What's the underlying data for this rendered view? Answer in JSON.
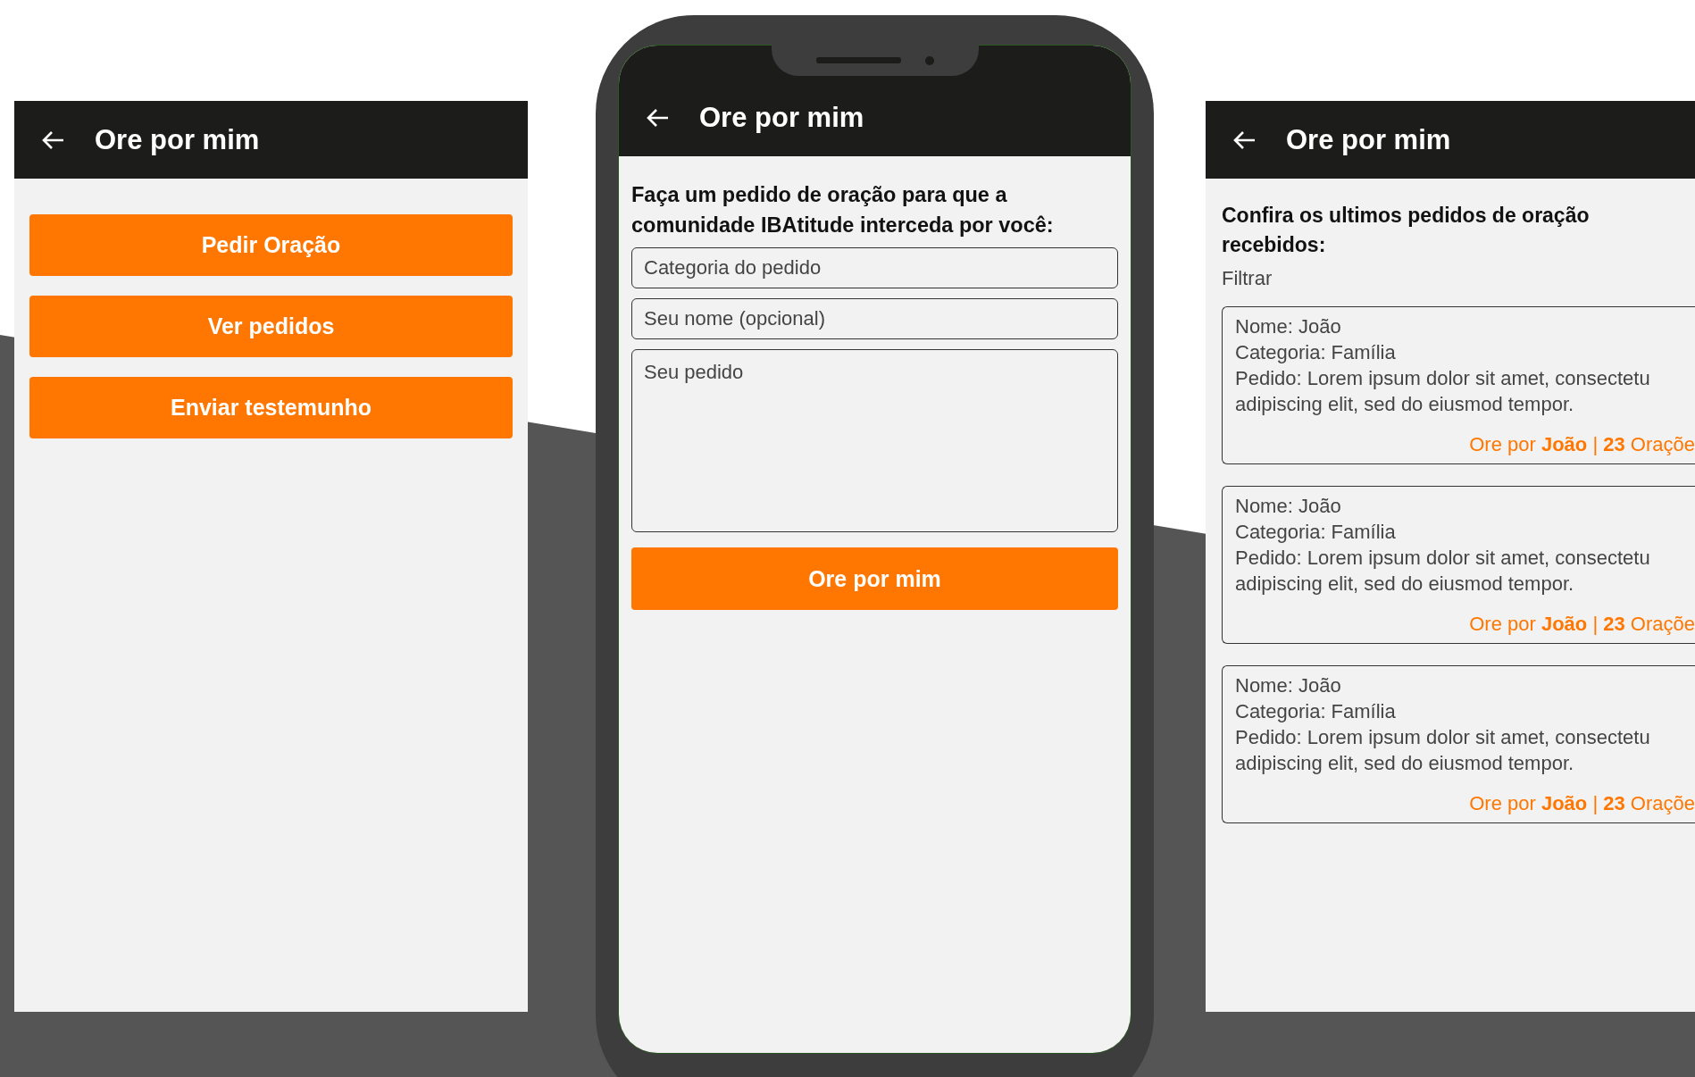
{
  "screens": [
    {
      "kind": "menu",
      "title": "Ore por mim",
      "buttons": [
        "Pedir Oração",
        "Ver pedidos",
        "Enviar testemunho"
      ]
    },
    {
      "kind": "form",
      "title": "Ore por mim",
      "prompt": "Faça um pedido de oração para que a comunidade IBAtitude interceda por você:",
      "fields": [
        {
          "kind": "input",
          "placeholder": "Categoria do pedido"
        },
        {
          "kind": "input",
          "placeholder": "Seu nome (opcional)"
        },
        {
          "kind": "textarea",
          "placeholder": "Seu pedido"
        }
      ],
      "submit": "Ore por mim"
    },
    {
      "kind": "list",
      "title": "Ore por mim",
      "heading": "Confira os ultimos pedidos de oração recebidos:",
      "filter": "Filtrar",
      "requests": [
        {
          "lines": [
            "Nome: João",
            "Categoria: Família",
            "Pedido: Lorem ipsum dolor sit amet, consectetu",
            "adipiscing elit, sed do eiusmod tempor."
          ],
          "action": "Ore por **João** | **23** Oraçõe"
        },
        {
          "lines": [
            "Nome: João",
            "Categoria: Família",
            "Pedido: Lorem ipsum dolor sit amet, consectetu",
            "adipiscing elit, sed do eiusmod tempor."
          ],
          "action": "Ore por **João** | **23** Oraçõe"
        },
        {
          "lines": [
            "Nome: João",
            "Categoria: Família",
            "Pedido: Lorem ipsum dolor sit amet, consectetu",
            "adipiscing elit, sed do eiusmod tempor."
          ],
          "action": "Ore por **João** | **23** Oraçõe"
        }
      ]
    }
  ]
}
